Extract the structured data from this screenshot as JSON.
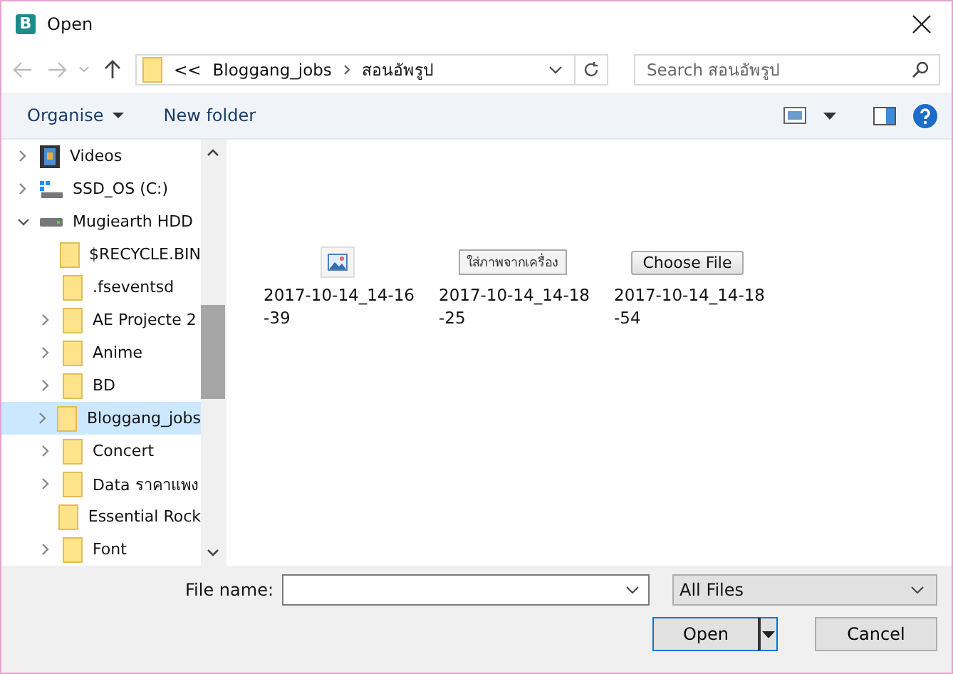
{
  "window": {
    "title": "Open",
    "app_icon_letter": "B"
  },
  "nav": {
    "breadcrumb": [
      "<<",
      "Bloggang_jobs",
      "สอนอัพรูป"
    ],
    "search": {
      "placeholder": "Search สอนอัพรูป"
    }
  },
  "toolbar": {
    "buttons": [
      "Organise",
      "New folder"
    ]
  },
  "sidebar": {
    "items": [
      {
        "label": "Videos",
        "kind": "video",
        "expandable": true,
        "expanded": false,
        "selected": false
      },
      {
        "label": "SSD_OS (C:)",
        "kind": "os-drive",
        "expandable": true,
        "expanded": false,
        "selected": false
      },
      {
        "label": "Mugiearth HDD",
        "kind": "drive",
        "expandable": true,
        "expanded": true,
        "selected": false,
        "children": [
          {
            "label": "$RECYCLE.BIN",
            "kind": "folder",
            "expandable": false,
            "selected": false
          },
          {
            "label": ".fseventsd",
            "kind": "folder",
            "expandable": false,
            "selected": false
          },
          {
            "label": "AE Projecte 2",
            "kind": "folder",
            "expandable": true,
            "expanded": false,
            "selected": false
          },
          {
            "label": "Anime",
            "kind": "folder",
            "expandable": true,
            "expanded": false,
            "selected": false
          },
          {
            "label": "BD",
            "kind": "folder",
            "expandable": true,
            "expanded": false,
            "selected": false
          },
          {
            "label": "Bloggang_jobs",
            "kind": "folder",
            "expandable": true,
            "expanded": false,
            "selected": true
          },
          {
            "label": "Concert",
            "kind": "folder",
            "expandable": true,
            "expanded": false,
            "selected": false
          },
          {
            "label": "Data ราคาแพง",
            "kind": "folder",
            "expandable": true,
            "expanded": false,
            "selected": false
          },
          {
            "label": "Essential Rock",
            "kind": "folder",
            "expandable": false,
            "selected": false
          },
          {
            "label": "Font",
            "kind": "folder",
            "expandable": true,
            "expanded": false,
            "selected": false
          }
        ]
      }
    ]
  },
  "files": [
    {
      "name": "2017-10-14_14-16\n-39",
      "kind": "image-icon"
    },
    {
      "name": "2017-10-14_14-18\n-25",
      "kind": "thai-button",
      "thumb_text": "ใส่ภาพจากเครื่อง"
    },
    {
      "name": "2017-10-14_14-18\n-54",
      "kind": "choose-button",
      "thumb_text": "Choose File"
    }
  ],
  "footer": {
    "file_name_label": "File name:",
    "file_type": "All Files",
    "buttons": [
      "Open",
      "Cancel"
    ]
  }
}
